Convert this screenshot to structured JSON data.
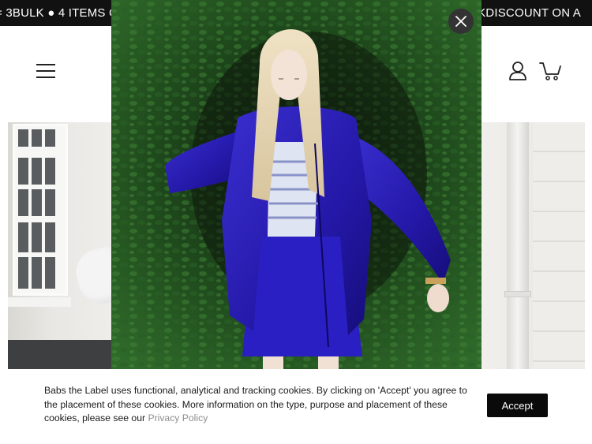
{
  "announcement": {
    "left_text": "= 3BULK ● 4 ITEMS C",
    "right_text": "ULKDISCOUNT ON A"
  },
  "header": {
    "menu_icon": "hamburger-icon",
    "account_icon": "user-icon",
    "cart_icon": "cart-icon"
  },
  "modal": {
    "close_icon": "close-icon",
    "image_alt": "Model wearing blue leather bomber jacket and skirt"
  },
  "cookie": {
    "text": "Babs the Label uses functional, analytical and tracking cookies. By clicking on 'Accept' you agree to the placement of these cookies. More information on the type, purpose and placement of these cookies, please see our",
    "link_label": "Privacy Policy",
    "accept_label": "Accept"
  }
}
